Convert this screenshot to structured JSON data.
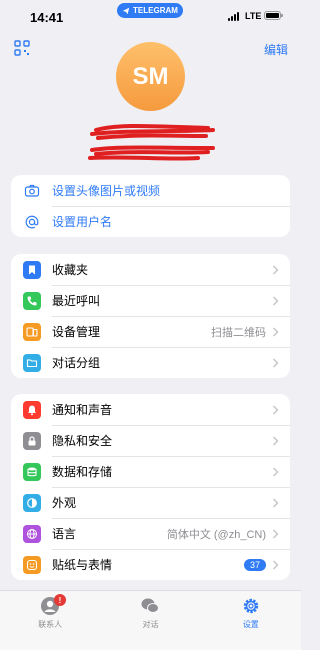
{
  "status": {
    "time": "14:41",
    "app_pill": "TELEGRAM",
    "network": "LTE"
  },
  "header": {
    "edit_label": "编辑",
    "avatar_initials": "SM"
  },
  "profile_actions": [
    {
      "label": "设置头像图片或视频",
      "icon": "camera-icon"
    },
    {
      "label": "设置用户名",
      "icon": "at-icon"
    }
  ],
  "group1": [
    {
      "label": "收藏夹",
      "icon": "bookmark-icon",
      "color": "#2f7bf5",
      "value": ""
    },
    {
      "label": "最近呼叫",
      "icon": "phone-icon",
      "color": "#34c759",
      "value": ""
    },
    {
      "label": "设备管理",
      "icon": "devices-icon",
      "color": "#f59a23",
      "value": "扫描二维码"
    },
    {
      "label": "对话分组",
      "icon": "folder-icon",
      "color": "#32ade6",
      "value": ""
    }
  ],
  "group2": [
    {
      "label": "通知和声音",
      "icon": "bell-icon",
      "color": "#ff3b30",
      "value": ""
    },
    {
      "label": "隐私和安全",
      "icon": "lock-icon",
      "color": "#8e8e93",
      "value": ""
    },
    {
      "label": "数据和存储",
      "icon": "database-icon",
      "color": "#34c759",
      "value": ""
    },
    {
      "label": "外观",
      "icon": "appearance-icon",
      "color": "#32ade6",
      "value": ""
    },
    {
      "label": "语言",
      "icon": "globe-icon",
      "color": "#af52de",
      "value": "简体中文 (@zh_CN)"
    },
    {
      "label": "贴纸与表情",
      "icon": "sticker-icon",
      "color": "#f59a23",
      "badge": "37"
    }
  ],
  "tabs": [
    {
      "label": "联系人",
      "icon": "contacts-icon",
      "badge": "!"
    },
    {
      "label": "对话",
      "icon": "chats-icon"
    },
    {
      "label": "设置",
      "icon": "settings-icon",
      "active": true
    }
  ]
}
